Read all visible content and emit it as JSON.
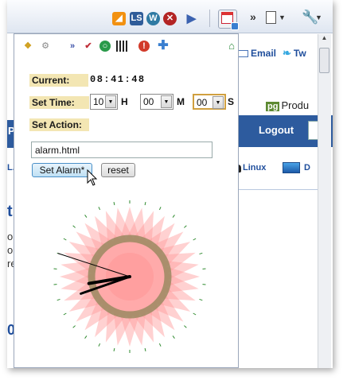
{
  "toolbar": {
    "icons": [
      "rss-icon",
      "ls-icon",
      "wordpress-icon",
      "stumble-icon",
      "play-icon",
      "alarm-clock-extension-icon",
      "chevron-overflow-icon",
      "page-menu-icon",
      "wrench-menu-icon"
    ],
    "ls_text": "LS",
    "overflow_text": "»"
  },
  "background_page": {
    "email_link": "Email",
    "twitter_fragment": "Tw",
    "product_fragment": "Produ",
    "pg_badge": "pg",
    "logout_label": "Logout",
    "linux_link": "Linux",
    "d_fragment": "D",
    "left_fragments": [
      "P",
      "L.P",
      "th",
      "or",
      "o",
      "re",
      "01"
    ]
  },
  "popup": {
    "icons": [
      "key-icon",
      "gear-icon",
      "arrows-icon",
      "check-icon",
      "green-circle-icon",
      "grid-icon",
      "stop-icon",
      "plus-icon",
      "home-icon"
    ],
    "current_label": "Current:",
    "current_time": "08:41:48",
    "set_time_label": "Set Time:",
    "hour_value": "10",
    "hour_unit": "H",
    "minute_value": "00",
    "minute_unit": "M",
    "second_value": "00",
    "second_unit": "S",
    "set_action_label": "Set Action:",
    "action_value": "alarm.html",
    "set_alarm_button": "Set Alarm*",
    "reset_button": "reset",
    "clock": {
      "hour": 8,
      "minute": 41,
      "second": 48,
      "colors": {
        "face": "#ff9a9a",
        "ring": "#9b8a62",
        "hands": "#000000",
        "ticks": "#2e8a2e"
      }
    }
  }
}
